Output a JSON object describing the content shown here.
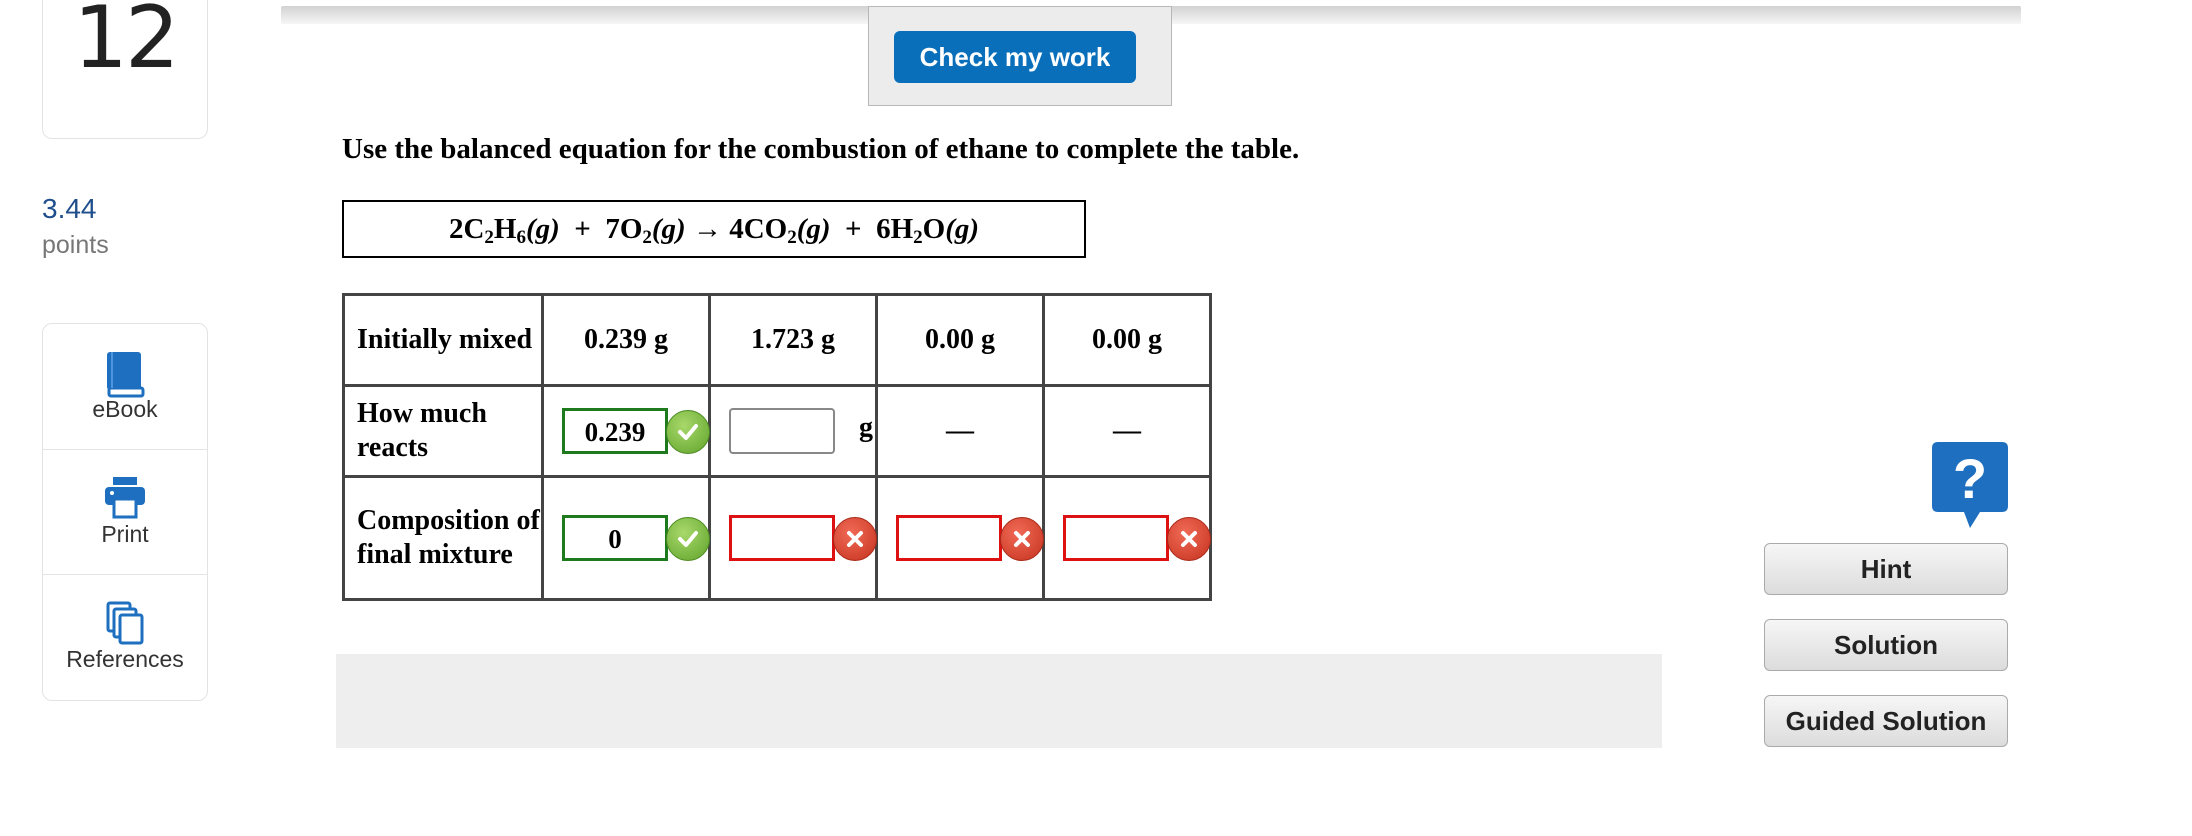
{
  "question": {
    "number": "12",
    "points_value": "3.44",
    "points_label": "points"
  },
  "tools": [
    {
      "label": "eBook",
      "icon": "book-icon"
    },
    {
      "label": "Print",
      "icon": "printer-icon"
    },
    {
      "label": "References",
      "icon": "copy-icon"
    }
  ],
  "check_button": "Check my work",
  "prompt": "Use the balanced equation for the combustion of ethane to complete the table.",
  "table": {
    "rows": [
      {
        "label": "Initially mixed",
        "values": [
          "0.239 g",
          "1.723 g",
          "0.00 g",
          "0.00 g"
        ]
      },
      {
        "label": "How much reacts",
        "input1": "0.239",
        "input2": "",
        "unit": "g",
        "dash3": "—",
        "dash4": "—"
      },
      {
        "label": "Composition of final mixture",
        "input1": "0",
        "input2": "",
        "input3": "",
        "input4": ""
      }
    ]
  },
  "help": {
    "hint": "Hint",
    "solution": "Solution",
    "guided": "Guided Solution",
    "icon": "question-icon"
  },
  "colors": {
    "accent": "#0a6fba",
    "correct": "#1d7a1d",
    "incorrect": "#dd1111"
  }
}
